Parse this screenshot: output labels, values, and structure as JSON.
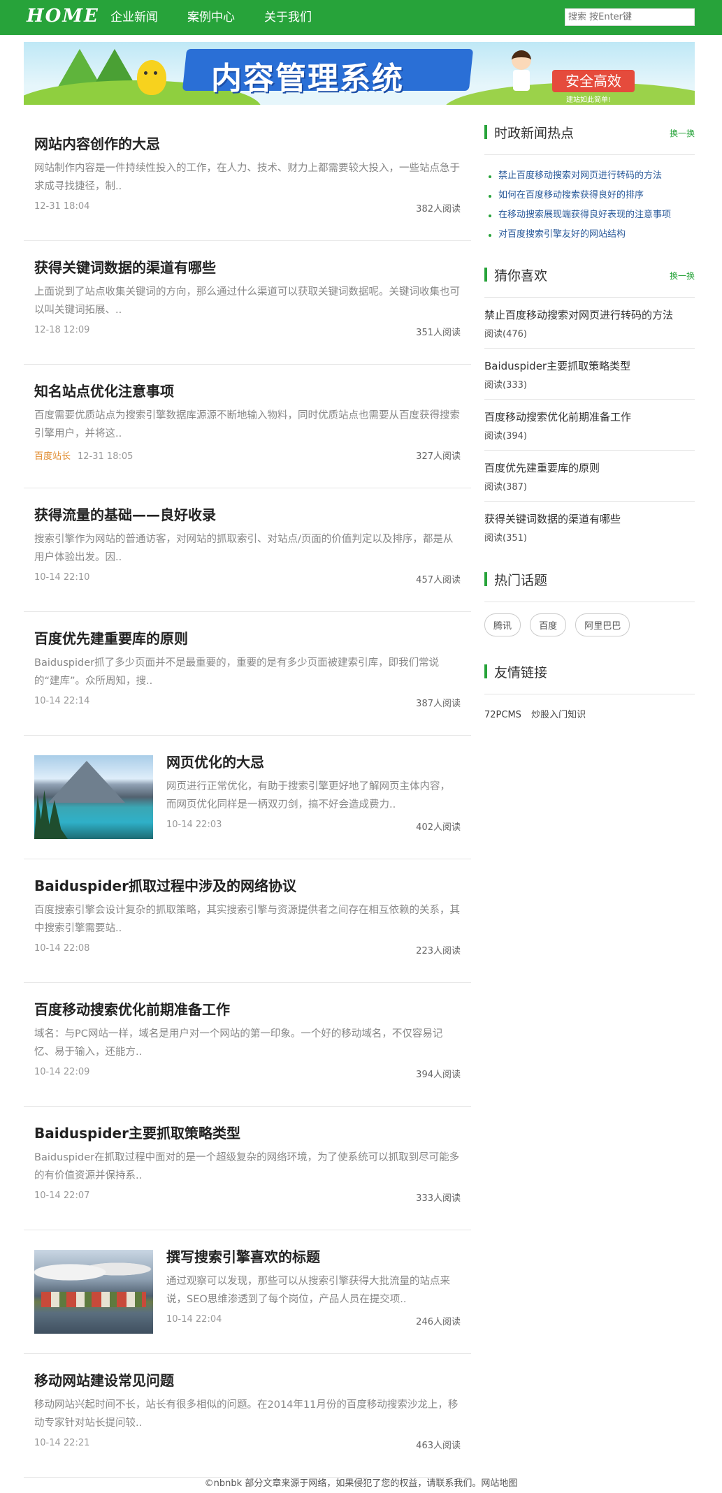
{
  "header": {
    "logo": "HOME",
    "nav": [
      "企业新闻",
      "案例中心",
      "关于我们"
    ],
    "search_placeholder": "搜索 按Enter键"
  },
  "banner": {
    "title": "内容管理系统",
    "badge": "安全高效",
    "tagline": "建站如此简单!"
  },
  "posts": [
    {
      "title": "网站内容创作的大忌",
      "desc": "网站制作内容是一件持续性投入的工作，在人力、技术、财力上都需要较大投入，一些站点急于求成寻找捷径，制..",
      "date": "12-31 18:04",
      "views": "382人阅读"
    },
    {
      "title": "获得关键词数据的渠道有哪些",
      "desc": "上面说到了站点收集关键词的方向，那么通过什么渠道可以获取关键词数据呢。关键词收集也可以叫关键词拓展、..",
      "date": "12-18 12:09",
      "views": "351人阅读"
    },
    {
      "title": "知名站点优化注意事项",
      "desc": "百度需要优质站点为搜索引擎数据库源源不断地输入物料，同时优质站点也需要从百度获得搜索引擎用户，并将这..",
      "source": "百度站长",
      "date": "12-31 18:05",
      "views": "327人阅读"
    },
    {
      "title": "获得流量的基础——良好收录",
      "desc": "搜索引擎作为网站的普通访客，对网站的抓取索引、对站点/页面的价值判定以及排序，都是从用户体验出发。因..",
      "date": "10-14 22:10",
      "views": "457人阅读"
    },
    {
      "title": "百度优先建重要库的原则",
      "desc": "Baiduspider抓了多少页面并不是最重要的，重要的是有多少页面被建索引库，即我们常说的“建库”。众所周知，搜..",
      "date": "10-14 22:14",
      "views": "387人阅读"
    },
    {
      "title": "网页优化的大忌",
      "desc": "网页进行正常优化，有助于搜索引擎更好地了解网页主体内容，而网页优化同样是一柄双刃剑，搞不好会造成费力..",
      "date": "10-14 22:03",
      "views": "402人阅读"
    },
    {
      "title": "Baiduspider抓取过程中涉及的网络协议",
      "desc": "百度搜索引擎会设计复杂的抓取策略，其实搜索引擎与资源提供者之间存在相互依赖的关系，其中搜索引擎需要站..",
      "date": "10-14 22:08",
      "views": "223人阅读"
    },
    {
      "title": "百度移动搜索优化前期准备工作",
      "desc": "域名：与PC网站一样，域名是用户对一个网站的第一印象。一个好的移动域名，不仅容易记忆、易于输入，还能方..",
      "date": "10-14 22:09",
      "views": "394人阅读"
    },
    {
      "title": "Baiduspider主要抓取策略类型",
      "desc": "Baiduspider在抓取过程中面对的是一个超级复杂的网络环境，为了使系统可以抓取到尽可能多的有价值资源并保持系..",
      "date": "10-14 22:07",
      "views": "333人阅读"
    },
    {
      "title": "撰写搜索引擎喜欢的标题",
      "desc": "通过观察可以发现，那些可以从搜索引擎获得大批流量的站点来说，SEO思维渗透到了每个岗位，产品人员在提交项..",
      "date": "10-14 22:04",
      "views": "246人阅读"
    },
    {
      "title": "移动网站建设常见问题",
      "desc": "移动网站兴起时间不长，站长有很多相似的问题。在2014年11月份的百度移动搜索沙龙上，移动专家针对站长提问较..",
      "date": "10-14 22:21",
      "views": "463人阅读"
    }
  ],
  "sidebar": {
    "hot_news": {
      "title": "时政新闻热点",
      "more": "换一换",
      "items": [
        "禁止百度移动搜索对网页进行转码的方法",
        "如何在百度移动搜索获得良好的排序",
        "在移动搜索展现端获得良好表现的注意事项",
        "对百度搜索引擎友好的网站结构"
      ]
    },
    "guess": {
      "title": "猜你喜欢",
      "more": "换一换",
      "items": [
        {
          "title": "禁止百度移动搜索对网页进行转码的方法",
          "count": "阅读(476)"
        },
        {
          "title": "Baiduspider主要抓取策略类型",
          "count": "阅读(333)"
        },
        {
          "title": "百度移动搜索优化前期准备工作",
          "count": "阅读(394)"
        },
        {
          "title": "百度优先建重要库的原则",
          "count": "阅读(387)"
        },
        {
          "title": "获得关键词数据的渠道有哪些",
          "count": "阅读(351)"
        }
      ]
    },
    "topics": {
      "title": "热门话题",
      "items": [
        "腾讯",
        "百度",
        "阿里巴巴"
      ]
    },
    "links": {
      "title": "友情链接",
      "items": [
        "72PCMS",
        "炒股入门知识"
      ]
    }
  },
  "footer": {
    "text": "©nbnbk 部分文章来源于网络，如果侵犯了您的权益，请联系我们。网站地图"
  }
}
